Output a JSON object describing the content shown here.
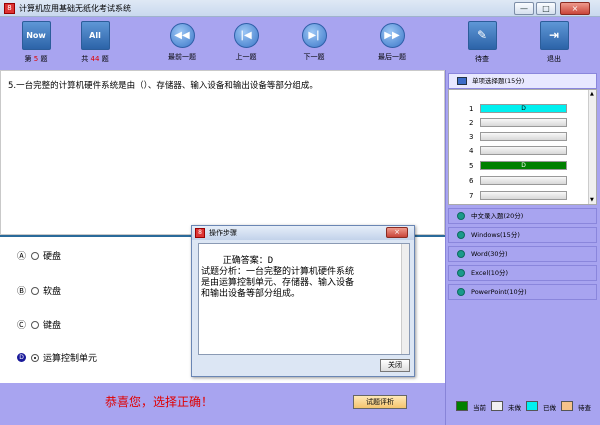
{
  "window": {
    "title": "计算机应用基础无纸化考试系统",
    "app_icon": "8",
    "min": "—",
    "max": "□",
    "close": "×"
  },
  "toolbar": {
    "now": {
      "icon": "Now",
      "pre": "第",
      "num": "5",
      "post": "题"
    },
    "all": {
      "icon": "All",
      "pre": "共",
      "num": "44",
      "post": "题"
    },
    "first": "最前一题",
    "prev": "上一题",
    "next": "下一题",
    "last": "最后一题",
    "pending": "待查",
    "exit": "退出"
  },
  "question": {
    "text": "5.一台完整的计算机硬件系统是由（）、存储器、输入设备和输出设备等部分组成。",
    "options": [
      {
        "letter": "A",
        "label": "硬盘",
        "selected": false
      },
      {
        "letter": "B",
        "label": "软盘",
        "selected": false
      },
      {
        "letter": "C",
        "label": "键盘",
        "selected": false
      },
      {
        "letter": "D",
        "label": "运算控制单元",
        "selected": true
      }
    ]
  },
  "feedback": "恭喜您，选择正确！",
  "analyze_button": "试题评析",
  "sidebar": {
    "active_section": "单项选择题(15分)",
    "questions": [
      {
        "num": "1",
        "answer": "D",
        "state": "done"
      },
      {
        "num": "2",
        "answer": "",
        "state": "todo"
      },
      {
        "num": "3",
        "answer": "",
        "state": "todo"
      },
      {
        "num": "4",
        "answer": "",
        "state": "todo"
      },
      {
        "num": "5",
        "answer": "D",
        "state": "current"
      },
      {
        "num": "6",
        "answer": "",
        "state": "todo"
      },
      {
        "num": "7",
        "answer": "",
        "state": "todo"
      }
    ],
    "sections": [
      "中文录入题(20分)",
      "Windows(15分)",
      "Word(30分)",
      "Excel(10分)",
      "PowerPoint(10分)"
    ],
    "legend": [
      {
        "label": "当前",
        "color": "#008000"
      },
      {
        "label": "未做",
        "color": "#f0f0f0"
      },
      {
        "label": "已做",
        "color": "#00f0f0"
      },
      {
        "label": "待查",
        "color": "#f5c28a"
      }
    ]
  },
  "dialog": {
    "title": "操作步骤",
    "body": "正确答案：D\n试题分析：一台完整的计算机硬件系统\n是由运算控制单元、存储器、输入设备\n和输出设备等部分组成。",
    "close_label": "关闭"
  }
}
